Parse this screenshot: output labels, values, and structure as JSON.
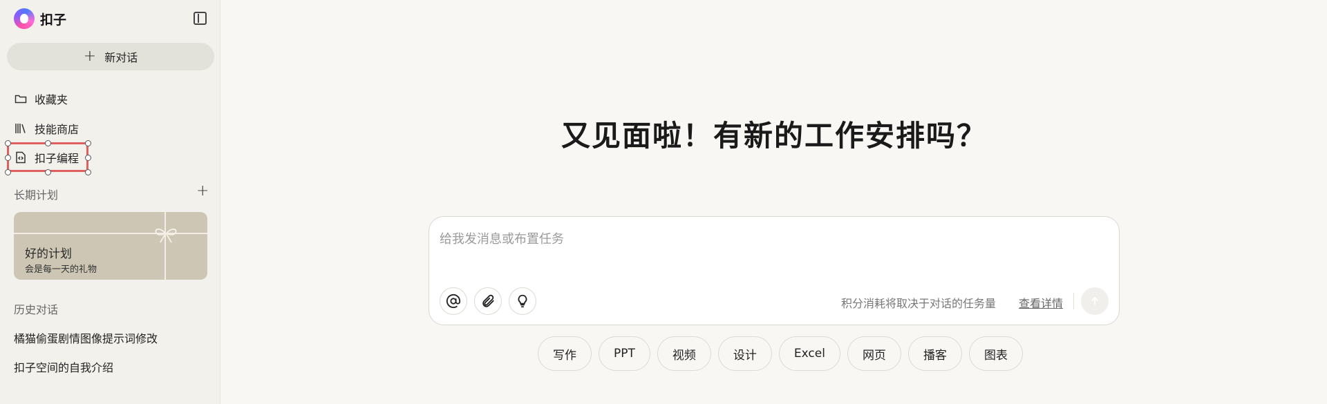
{
  "brand": {
    "name": "扣子",
    "logo_icon": "coze-logo-icon"
  },
  "sidebar": {
    "collapse_icon": "sidebar-toggle-icon",
    "new_chat": {
      "label": "新对话",
      "icon": "plus-icon"
    },
    "nav": [
      {
        "label": "收藏夹",
        "icon": "folder-icon"
      },
      {
        "label": "技能商店",
        "icon": "library-icon"
      },
      {
        "label": "扣子编程",
        "icon": "code-file-icon"
      }
    ],
    "plans_label": "长期计划",
    "plan_card": {
      "title": "好的计划",
      "subtitle": "会是每一天的礼物"
    },
    "history_label": "历史对话",
    "history": [
      {
        "label": "橘猫偷蛋剧情图像提示词修改"
      },
      {
        "label": "扣子空间的自我介绍"
      }
    ]
  },
  "main": {
    "headline": "又见面啦！有新的工作安排吗？",
    "composer": {
      "placeholder": "给我发消息或布置任务",
      "value": "",
      "tools": [
        "at-icon",
        "paperclip-icon",
        "lightbulb-icon"
      ],
      "credit_note": "积分消耗将取决于对话的任务量",
      "details_link": "查看详情",
      "send_icon": "arrow-up-icon"
    },
    "chips": [
      "写作",
      "PPT",
      "视频",
      "设计",
      "Excel",
      "网页",
      "播客",
      "图表"
    ]
  },
  "colors": {
    "background": "#f8f7f4",
    "sidebar": "#f2f1ec",
    "new_chat_bg": "#e3e2da",
    "plan_card_bg": "#cdc6b4",
    "selection_outline": "#e06060"
  }
}
